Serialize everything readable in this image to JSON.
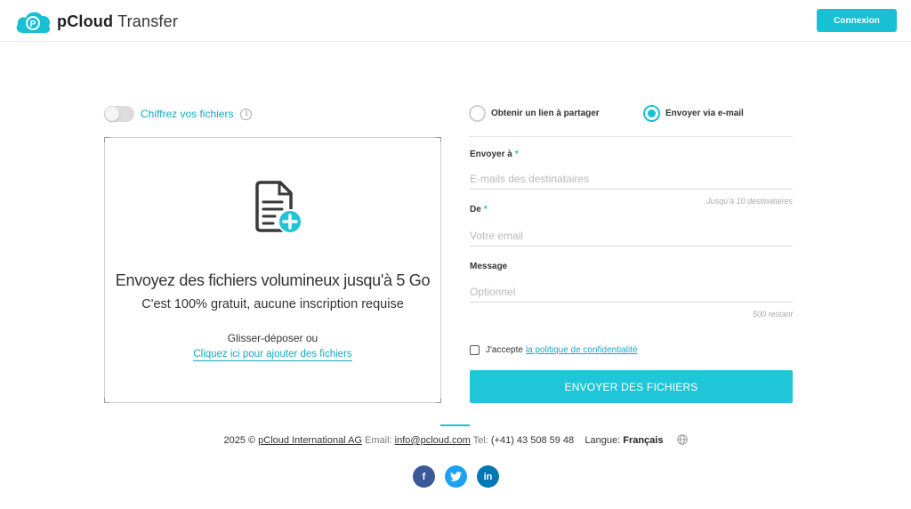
{
  "header": {
    "brand_bold": "pCloud",
    "brand_product": "Transfer",
    "login_label": "Connexion"
  },
  "encrypt": {
    "label": "Chiffrez vos fichiers",
    "info": "i"
  },
  "dropzone": {
    "title": "Envoyez des fichiers volumineux jusqu'à 5 Go",
    "subtitle": "C'est 100% gratuit, aucune inscription requise",
    "drag_text": "Glisser-déposer ou",
    "click_text": "Cliquez ici pour ajouter des fichiers"
  },
  "modes": {
    "link_label": "Obtenir un lien à partager",
    "email_label": "Envoyer via e-mail",
    "selected": "email"
  },
  "form": {
    "to_label": "Envoyer à",
    "to_placeholder": "E-mails des destinataires",
    "to_hint": "Jusqu'à 10 destinataires",
    "from_label": "De",
    "from_placeholder": "Votre email",
    "message_label": "Message",
    "message_placeholder": "Optionnel",
    "message_hint": "500 restant",
    "required_mark": "*"
  },
  "consent": {
    "text": "J'accepte",
    "link": "la politique de confidentialité"
  },
  "send_label": "ENVOYER DES FICHIERS",
  "footer": {
    "year": "2025 ©",
    "company": "pCloud International AG",
    "email_label": "Email:",
    "email": "info@pcloud.com",
    "tel_label": "Tel:",
    "tel": "(+41) 43 508 59 48",
    "lang_label": "Langue:",
    "lang": "Français"
  },
  "socials": [
    {
      "name": "facebook",
      "glyph": "f",
      "color": "#3b5998"
    },
    {
      "name": "twitter",
      "glyph": "t",
      "color": "#1da1f2"
    },
    {
      "name": "linkedin",
      "glyph": "in",
      "color": "#0077b5"
    }
  ],
  "colors": {
    "accent": "#17c1d3",
    "link": "#17a9c0"
  }
}
